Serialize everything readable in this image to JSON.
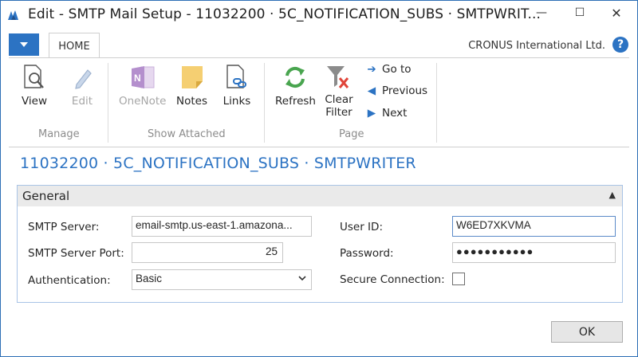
{
  "window": {
    "title": "Edit - SMTP Mail Setup - 11032200 · 5C_NOTIFICATION_SUBS · SMTPWRIT...",
    "minimize": "—",
    "maximize": "☐",
    "close": "✕"
  },
  "ribbon": {
    "tab": "HOME",
    "company": "CRONUS International Ltd.",
    "help": "?",
    "groups": {
      "manage": {
        "label": "Manage",
        "view": "View",
        "edit": "Edit"
      },
      "show_attached": {
        "label": "Show Attached",
        "onenote": "OneNote",
        "notes": "Notes",
        "links": "Links"
      },
      "page": {
        "label": "Page",
        "refresh": "Refresh",
        "clear_filter_line1": "Clear",
        "clear_filter_line2": "Filter",
        "go_to": "Go to",
        "previous": "Previous",
        "next": "Next"
      }
    }
  },
  "page": {
    "title": "11032200 · 5C_NOTIFICATION_SUBS · SMTPWRITER"
  },
  "general": {
    "header": "General",
    "collapse_icon": "^",
    "smtp_server_label": "SMTP Server:",
    "smtp_server_value": "email-smtp.us-east-1.amazona...",
    "smtp_port_label": "SMTP Server Port:",
    "smtp_port_value": "25",
    "auth_label": "Authentication:",
    "auth_value": "Basic",
    "user_id_label": "User ID:",
    "user_id_value": "W6ED7XKVMA",
    "password_label": "Password:",
    "password_value": "●●●●●●●●●●●",
    "secure_label": "Secure Connection:",
    "secure_checked": false
  },
  "footer": {
    "ok": "OK"
  },
  "colors": {
    "accent": "#2c73c3",
    "fasttab_border": "#a9c4e6"
  }
}
